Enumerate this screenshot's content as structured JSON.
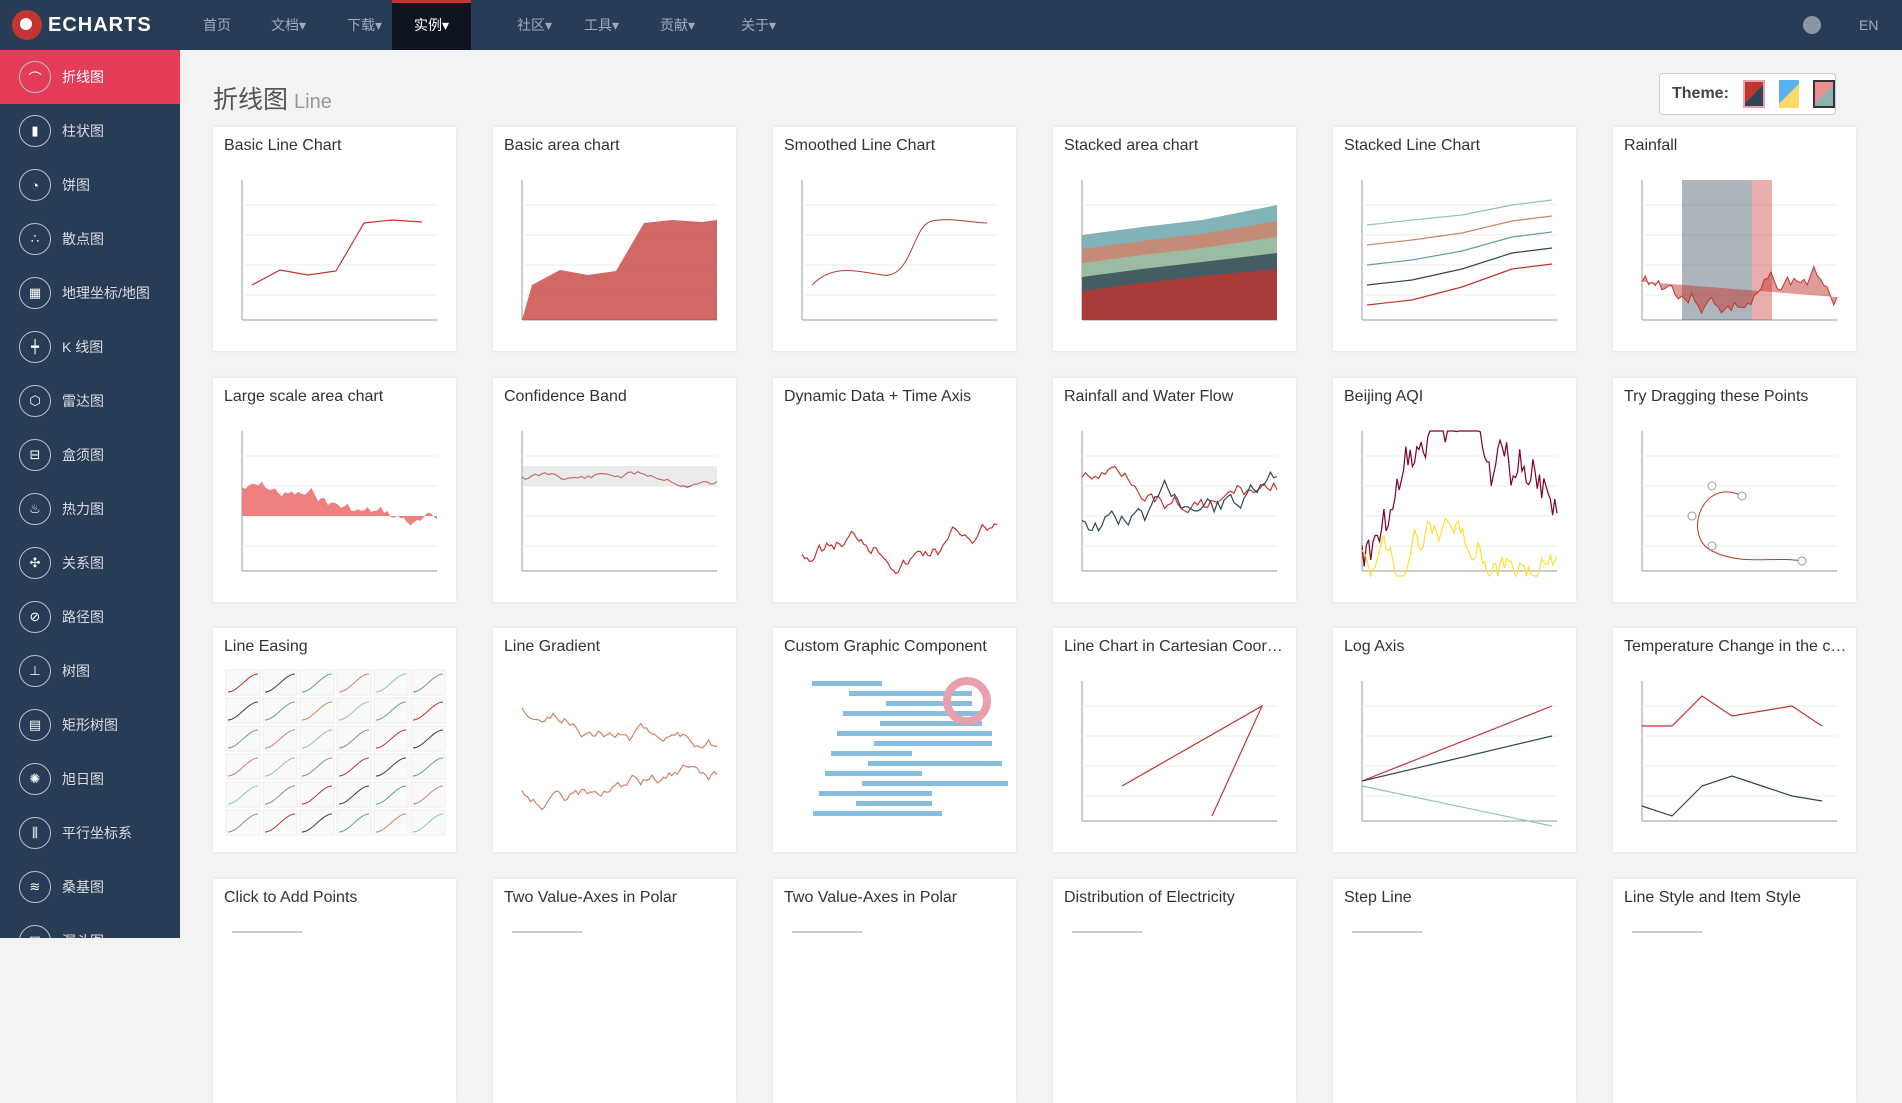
{
  "nav": {
    "brand": "ECHARTS",
    "items": [
      {
        "label": "首页"
      },
      {
        "label": "文档▾"
      },
      {
        "label": "下载▾"
      },
      {
        "label": "实例▾",
        "active": true
      },
      {
        "label": "社区▾"
      },
      {
        "label": "工具▾"
      },
      {
        "label": "贡献▾"
      },
      {
        "label": "关于▾"
      }
    ],
    "lang": "EN",
    "github_icon": "github-icon"
  },
  "sidebar": {
    "items": [
      {
        "label": "折线图",
        "icon": "line-chart-icon",
        "active": true
      },
      {
        "label": "柱状图",
        "icon": "bar-chart-icon"
      },
      {
        "label": "饼图",
        "icon": "pie-chart-icon"
      },
      {
        "label": "散点图",
        "icon": "scatter-icon"
      },
      {
        "label": "地理坐标/地图",
        "icon": "map-icon"
      },
      {
        "label": "K 线图",
        "icon": "candlestick-icon"
      },
      {
        "label": "雷达图",
        "icon": "radar-icon"
      },
      {
        "label": "盒须图",
        "icon": "boxplot-icon"
      },
      {
        "label": "热力图",
        "icon": "heatmap-icon"
      },
      {
        "label": "关系图",
        "icon": "graph-icon"
      },
      {
        "label": "路径图",
        "icon": "lines-icon"
      },
      {
        "label": "树图",
        "icon": "tree-icon"
      },
      {
        "label": "矩形树图",
        "icon": "treemap-icon"
      },
      {
        "label": "旭日图",
        "icon": "sunburst-icon"
      },
      {
        "label": "平行坐标系",
        "icon": "parallel-icon"
      },
      {
        "label": "桑基图",
        "icon": "sankey-icon"
      },
      {
        "label": "漏斗图",
        "icon": "funnel-icon"
      }
    ]
  },
  "page": {
    "title": "折线图",
    "subtitle": "Line"
  },
  "theme": {
    "label": "Theme:",
    "options": [
      {
        "colors": [
          "#c23531",
          "#2f4554"
        ],
        "selected": true
      },
      {
        "colors": [
          "#5ab1ef",
          "#ffd966"
        ]
      },
      {
        "colors": [
          "#e98f8f",
          "#8fb1b1"
        ]
      }
    ]
  },
  "examples": [
    {
      "title": "Basic Line Chart",
      "thumb": "line"
    },
    {
      "title": "Basic area chart",
      "thumb": "area"
    },
    {
      "title": "Smoothed Line Chart",
      "thumb": "smooth"
    },
    {
      "title": "Stacked area chart",
      "thumb": "stacked"
    },
    {
      "title": "Stacked Line Chart",
      "thumb": "multi"
    },
    {
      "title": "Rainfall",
      "thumb": "rain"
    },
    {
      "title": "Large scale area chart",
      "thumb": "large"
    },
    {
      "title": "Confidence Band",
      "thumb": "band"
    },
    {
      "title": "Dynamic Data + Time Axis",
      "thumb": "noisy"
    },
    {
      "title": "Rainfall and Water Flow",
      "thumb": "flow"
    },
    {
      "title": "Beijing AQI",
      "thumb": "aqi"
    },
    {
      "title": "Try Dragging these Points",
      "thumb": "drag"
    },
    {
      "title": "Line Easing",
      "thumb": "grid"
    },
    {
      "title": "Line Gradient",
      "thumb": "gradient"
    },
    {
      "title": "Custom Graphic Component",
      "thumb": "bars"
    },
    {
      "title": "Line Chart in Cartesian Coordinate System",
      "thumb": "diag"
    },
    {
      "title": "Log Axis",
      "thumb": "log"
    },
    {
      "title": "Temperature Change in the coming week",
      "thumb": "temp"
    },
    {
      "title": "Click to Add Points",
      "thumb": "blank"
    },
    {
      "title": "Two Value-Axes in Polar",
      "thumb": "blank"
    },
    {
      "title": "Two Value-Axes in Polar",
      "thumb": "blank"
    },
    {
      "title": "Distribution of Electricity",
      "thumb": "blank"
    },
    {
      "title": "Step Line",
      "thumb": "blank"
    },
    {
      "title": "Line Style and Item Style",
      "thumb": "blank"
    }
  ]
}
